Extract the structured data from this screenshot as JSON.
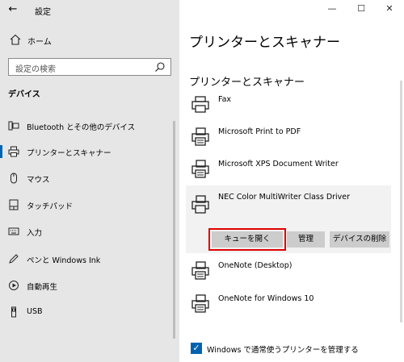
{
  "window": {
    "title": "設定",
    "minimize": "—",
    "maximize": "☐",
    "close": "✕"
  },
  "nav": {
    "back": "←",
    "home_label": "ホーム",
    "search_placeholder": "設定の検索",
    "section_title": "デバイス",
    "items": [
      {
        "label": "Bluetooth とその他のデバイス",
        "icon": "bluetooth-devices-icon"
      },
      {
        "label": "プリンターとスキャナー",
        "icon": "printer-icon"
      },
      {
        "label": "マウス",
        "icon": "mouse-icon"
      },
      {
        "label": "タッチパッド",
        "icon": "touchpad-icon"
      },
      {
        "label": "入力",
        "icon": "keyboard-icon"
      },
      {
        "label": "ペンと Windows Ink",
        "icon": "pen-icon"
      },
      {
        "label": "自動再生",
        "icon": "autoplay-icon"
      },
      {
        "label": "USB",
        "icon": "usb-icon"
      }
    ]
  },
  "main": {
    "page_title": "プリンターとスキャナー",
    "section_title": "プリンターとスキャナー",
    "printers": [
      "Fax",
      "Microsoft Print to PDF",
      "Microsoft XPS Document Writer",
      "NEC Color MultiWriter Class Driver",
      "OneNote (Desktop)",
      "OneNote for Windows 10"
    ],
    "buttons": {
      "open_queue": "キューを開く",
      "manage": "管理",
      "remove": "デバイスの削除"
    },
    "default_checkbox_label": "Windows で通常使うプリンターを管理する"
  },
  "colors": {
    "accent": "#0063b1",
    "highlight": "#e00000",
    "sidebar_bg": "#e6e6e6"
  }
}
